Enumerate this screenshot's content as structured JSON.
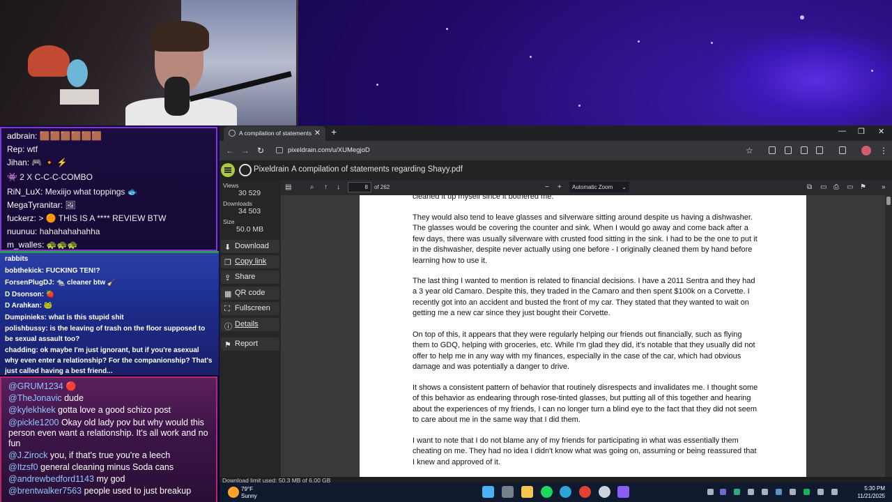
{
  "chat_top": [
    {
      "user": "adbrain:",
      "msg": " 🟫🟫🟫🟫🟫🟫"
    },
    {
      "user": "Rep:",
      "msg": " wtf"
    },
    {
      "user": "Jihan:",
      "msg": " 🎮 🔸 ⚡"
    },
    {
      "user": "",
      "msg": "👾 2 X C-C-C-COMBO"
    },
    {
      "user": "RiN_LuX:",
      "msg": " Mexiijo what toppings 🐟"
    },
    {
      "user": "MegaTyranitar:",
      "msg": " 🖼"
    },
    {
      "user": "fuckerz:",
      "msg": " > 🟠 THIS IS A **** REVIEW BTW"
    },
    {
      "user": "nuunuu:",
      "msg": " hahahahahahha"
    },
    {
      "user": "m_walles:",
      "msg": " 🐢🐢🐢"
    }
  ],
  "chat_mid": [
    {
      "text": "rabbits"
    },
    {
      "text": "bobthekick: FUCKING TEN!?"
    },
    {
      "text": "ForsenPlugDJ: 🐀 cleaner btw 🧹"
    },
    {
      "text": "D Dsonson: 🍓"
    },
    {
      "text": "D Arahkan: 🐸"
    },
    {
      "text": "Dumpinieks: what is this stupid shit"
    },
    {
      "text": "polishbussy: is the leaving of trash on the floor supposed to be sexual assault too?"
    },
    {
      "text": "chadding: ok maybe I'm just ignorant, but if you're asexual why even enter a relationship? For the companionship? That's just called having a best friend..."
    }
  ],
  "chat_bottom": [
    {
      "user": "@GRUM1234",
      "msg": " 🔴"
    },
    {
      "user": "@TheJonavic",
      "msg": " dude"
    },
    {
      "user": "@kylekhkek",
      "msg": " gotta love a good schizo post"
    },
    {
      "user": "@pickle1200",
      "msg": " Okay old lady pov but why would this person even want a relationship. It's all work and no fun"
    },
    {
      "user": "@J.Zirock",
      "msg": " you, if that's true you're a leech"
    },
    {
      "user": "@Itzsf0",
      "msg": " general cleaning minus Soda cans"
    },
    {
      "user": "@andrewbedford1143",
      "msg": " my god"
    },
    {
      "user": "@brentwalker7563",
      "msg": " people used to just breakup"
    }
  ],
  "browser": {
    "tab_title": "A compilation of statements re",
    "url": "pixeldrain.com/u/XUMegjoD"
  },
  "pixeldrain": {
    "brand": "Pixeldrain",
    "doc_title": "A compilation of statements regarding Shayy.pdf",
    "views_label": "Views",
    "views": "30 529",
    "downloads_label": "Downloads",
    "downloads": "34 503",
    "size_label": "Size",
    "size": "50.0 MB",
    "buttons": [
      "Download",
      "Copy link",
      "Share",
      "QR code",
      "Fullscreen",
      "Details",
      "Report"
    ],
    "status": "Download limit used: 50.3 MB of 6.00 GB"
  },
  "pdf": {
    "page": "8",
    "of": "of 262",
    "zoom": "Automatic Zoom",
    "partial_top": "cleaned it up myself since it bothered me.",
    "paragraphs": [
      "They would also tend to leave glasses and silverware sitting around despite us having a dishwasher. The glasses would be covering the counter and sink. When I would go away and come back after a few days, there was usually silverware with crusted food sitting in the sink. I had to be the one to put it in the dishwasher, despite never actually using one before - I originally cleaned them by hand before learning how to use it.",
      "The last thing I wanted to mention is related to financial decisions. I have a 2011 Sentra and they had a 3 year old Camaro. Despite this, they traded in the Camaro and then spent $100k on a Corvette. I recently got into an accident and busted the front of my car. They stated that they wanted to wait on getting me a new car since they just bought their Corvette.",
      "On top of this, it appears that they were regularly helping our friends out financially, such as flying them to GDQ, helping with groceries, etc. While I'm glad they did, it's notable that they usually did not offer to help me in any way with my finances, especially in the case of the car, which had obvious damage and was potentially a danger to drive.",
      "It shows a consistent pattern of behavior that routinely disrespects and invalidates me. I thought some of this behavior as endearing through rose-tinted glasses, but putting all of this together and hearing about the experiences of my friends, I can no longer turn a blind eye to the fact that they did not seem to care about me in the same way that I did them.",
      "I want to note that I do not blame any of my friends for participating in what was essentially them cheating on me. They had no idea I didn't know what was going on, assuming or being reassured that I knew and approved of it."
    ]
  },
  "taskbar": {
    "temp": "79°F",
    "condition": "Sunny",
    "time": "5:30 PM",
    "date": "11/21/2025"
  }
}
